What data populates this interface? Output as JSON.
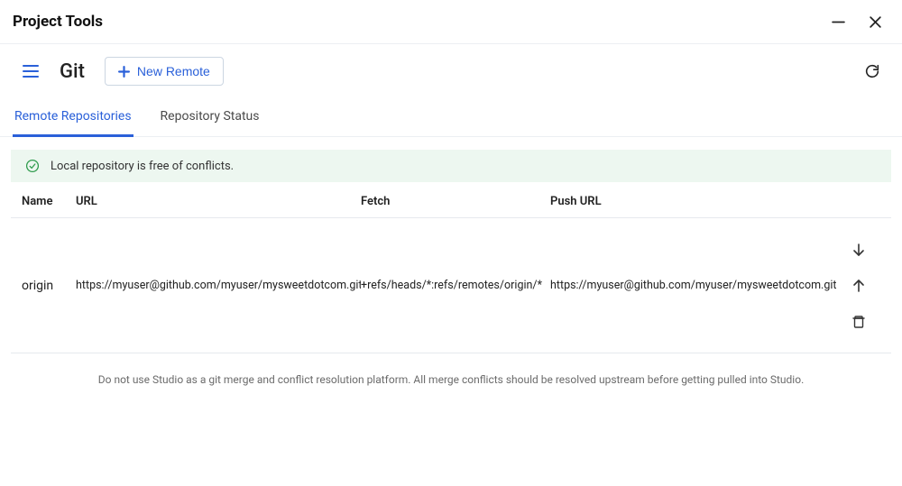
{
  "window": {
    "title": "Project Tools"
  },
  "toolbar": {
    "page_heading": "Git",
    "new_remote_label": "New Remote"
  },
  "tabs": {
    "remote_repositories": "Remote Repositories",
    "repository_status": "Repository Status"
  },
  "banner": {
    "message": "Local repository is free of conflicts."
  },
  "table": {
    "headers": {
      "name": "Name",
      "url": "URL",
      "fetch": "Fetch",
      "push_url": "Push URL"
    },
    "rows": [
      {
        "name": "origin",
        "url": "https://myuser@github.com/myuser/mysweetdotcom.git",
        "fetch": "+refs/heads/*:refs/remotes/origin/*",
        "push_url": "https://myuser@github.com/myuser/mysweetdotcom.git"
      }
    ]
  },
  "footnote": "Do not use Studio as a git merge and conflict resolution platform. All merge conflicts should be resolved upstream before getting pulled into Studio."
}
